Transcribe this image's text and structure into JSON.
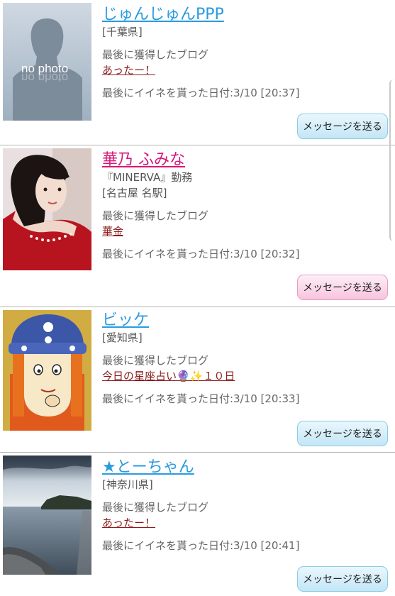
{
  "users": [
    {
      "name": "じゅんじゅんPPP",
      "name_color": "blue",
      "details": [
        "[千葉県]"
      ],
      "blog_label": "最後に獲得したブログ",
      "blog_title": "あったー！",
      "date_text": "最後にイイネを貰った日付:3/10 [20:37]",
      "button_label": "メッセージを送る",
      "button_color": "blue",
      "avatar": "no-photo-silhouette",
      "avatar_text": "no photo"
    },
    {
      "name": "華乃 ふみな",
      "name_color": "pink",
      "details": [
        "『MINERVA』勤務",
        "[名古屋 名駅]"
      ],
      "blog_label": "最後に獲得したブログ",
      "blog_title": "華金",
      "date_text": "最後にイイネを貰った日付:3/10 [20:32]",
      "button_label": "メッセージを送る",
      "button_color": "pink",
      "avatar": "woman-portrait-photo"
    },
    {
      "name": "ビッケ",
      "name_color": "blue",
      "details": [
        "[愛知県]"
      ],
      "blog_label": "最後に獲得したブログ",
      "blog_title": "今日の星座占い🔮✨１０日",
      "date_text": "最後にイイネを貰った日付:3/10 [20:33]",
      "button_label": "メッセージを送る",
      "button_color": "blue",
      "avatar": "viking-cartoon-character"
    },
    {
      "name": "★とーちゃん",
      "name_color": "blue",
      "details": [
        "[神奈川県]"
      ],
      "blog_label": "最後に獲得したブログ",
      "blog_title": "あったー！",
      "date_text": "最後にイイネを貰った日付:3/10 [20:41]",
      "button_label": "メッセージを送る",
      "button_color": "blue",
      "avatar": "seaside-landscape-photo"
    }
  ],
  "colors": {
    "name_blue": "#2a9be0",
    "name_pink": "#d8187a",
    "blog_link": "#8a1c1c",
    "divider": "#b5b5b5"
  }
}
